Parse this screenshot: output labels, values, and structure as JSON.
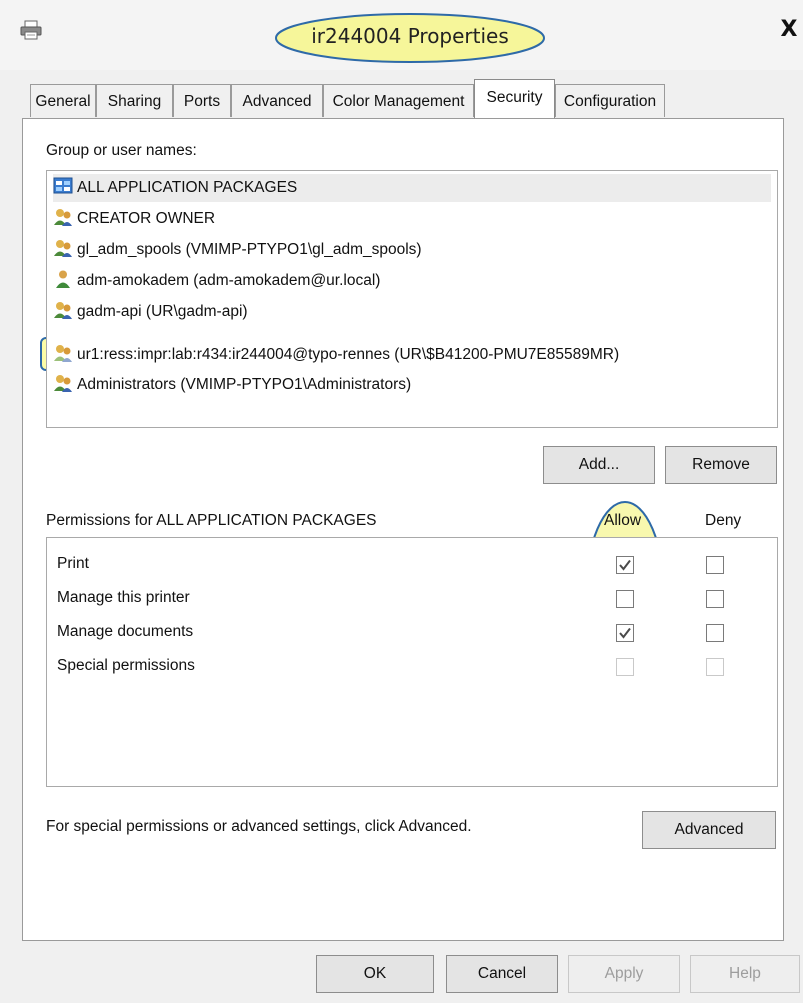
{
  "window": {
    "title": "ir244004 Properties",
    "close_label": "X",
    "icon": "printer-icon"
  },
  "tabs": [
    "General",
    "Sharing",
    "Ports",
    "Advanced",
    "Color Management",
    "Security",
    "Configuration"
  ],
  "active_tab": "Security",
  "security": {
    "group_label": "Group or user names:",
    "users": [
      {
        "name": "ALL APPLICATION PACKAGES",
        "icon": "app-packages-icon"
      },
      {
        "name": "CREATOR OWNER",
        "icon": "group-icon"
      },
      {
        "name": "gl_adm_spools (VMIMP-PTYPO1\\gl_adm_spools)",
        "icon": "group-icon"
      },
      {
        "name": "adm-amokadem (adm-amokadem@ur.local)",
        "icon": "user-icon"
      },
      {
        "name": "gadm-api (UR\\gadm-api)",
        "icon": "group-icon"
      },
      {
        "name": "ur1:ress:impr:lab:r434:ir244004@typo-rennes (UR\\$B41200-PMU7E85589MR)",
        "icon": "group-icon"
      },
      {
        "name": "Administrators (VMIMP-PTYPO1\\Administrators)",
        "icon": "group-icon"
      }
    ],
    "add_label": "Add...",
    "remove_label": "Remove",
    "permissions_label": "Permissions for ALL APPLICATION PACKAGES",
    "allow_header": "Allow",
    "deny_header": "Deny",
    "permissions": [
      {
        "name": "Print",
        "allow": true,
        "deny": false,
        "enabled": true
      },
      {
        "name": "Manage this printer",
        "allow": false,
        "deny": false,
        "enabled": true
      },
      {
        "name": "Manage documents",
        "allow": true,
        "deny": false,
        "enabled": true
      },
      {
        "name": "Special permissions",
        "allow": false,
        "deny": false,
        "enabled": false
      }
    ],
    "advanced_hint": "For special permissions or advanced settings, click Advanced.",
    "advanced_label": "Advanced"
  },
  "footer": {
    "ok_label": "OK",
    "cancel_label": "Cancel",
    "apply_label": "Apply",
    "help_label": "Help"
  },
  "colors": {
    "annotation_fill": "#fafa78",
    "annotation_stroke": "#2e6aa8",
    "check": "#4a4a4a"
  }
}
